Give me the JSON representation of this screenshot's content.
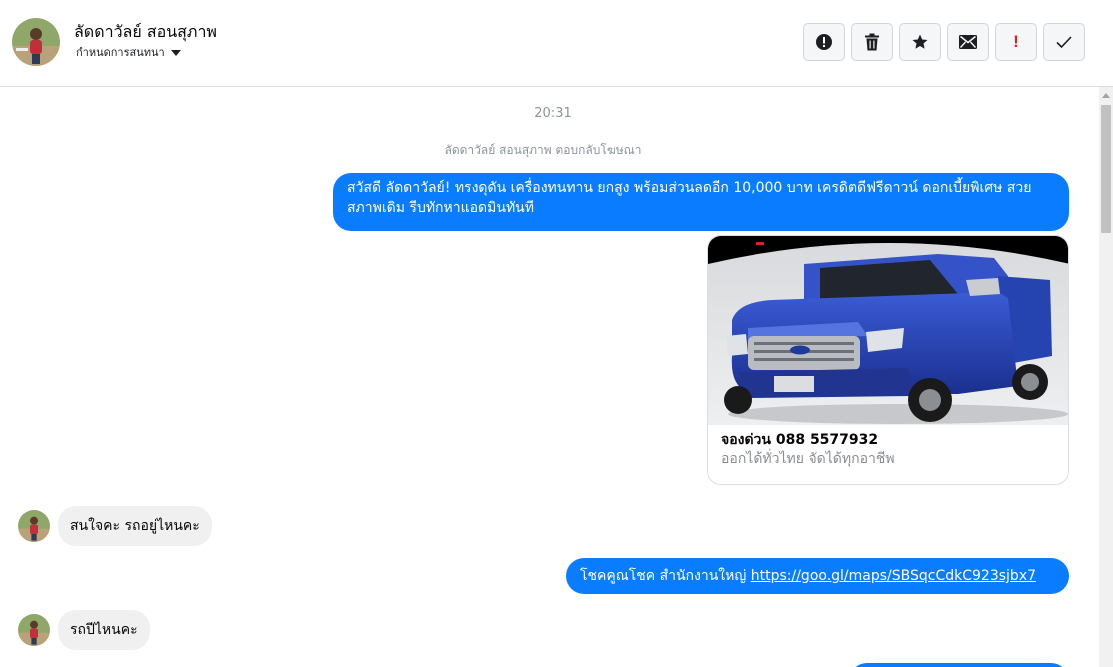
{
  "header": {
    "contact_name": "ลัดดาวัลย์ สอนสุภาพ",
    "assign_label": "กำหนดการสนทนา"
  },
  "toolbar": {
    "items": [
      "info-icon",
      "trash-icon",
      "star-icon",
      "envelope-icon",
      "exclamation-icon",
      "check-icon"
    ],
    "exclamation_glyph": "!"
  },
  "conversation": {
    "timestamp": "20:31",
    "ad_reply_note": "ลัดดาวัลย์ สอนสุภาพ ตอบกลับโฆษณา",
    "messages": [
      {
        "direction": "outgoing",
        "text": "สวัสดี ลัดดาวัลย์!  ทรงดุดัน เครื่องทนทาน ยกสูง พร้อมส่วนลดอีก 10,000 บาท เครดิตดีฟรีดาวน์ ดอกเบี้ยพิเศษ สวยสภาพเดิม รีบทักหาแอดมินทันที"
      },
      {
        "direction": "outgoing",
        "type": "card",
        "title": "จองด่วน 088 5577932",
        "subtitle": "ออกได้ทั่วไทย จัดได้ทุกอาชีพ",
        "image": "blue-pickup-truck"
      },
      {
        "direction": "incoming",
        "text": "สนใจคะ รถอยู่ไหนคะ"
      },
      {
        "direction": "outgoing",
        "text": "โชคคูณโชค สำนักงานใหญ่ ",
        "link": "https://goo.gl/maps/SBSqcCdkC923sjbx7"
      },
      {
        "direction": "incoming",
        "text": "รถปีไหนคะ"
      }
    ]
  },
  "colors": {
    "outgoing_bubble": "#0a7cff",
    "incoming_bubble": "#f0f0f0",
    "muted_text": "#8d949e"
  }
}
